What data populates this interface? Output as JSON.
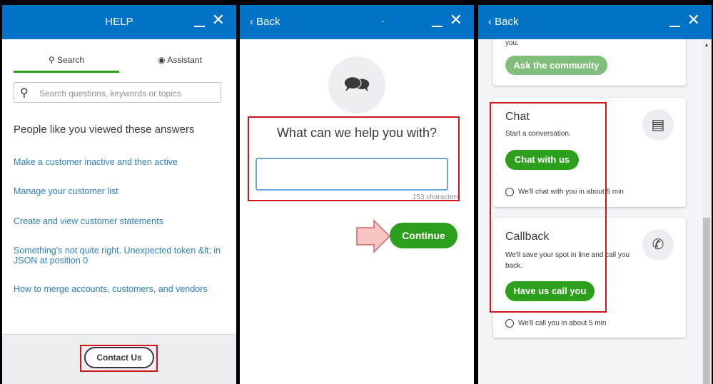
{
  "panel1": {
    "title": "HELP",
    "tabs": [
      {
        "label": "Search",
        "active": true
      },
      {
        "label": "Assistant"
      }
    ],
    "search_placeholder": "Search questions, keywords or topics",
    "heading": "People like you viewed these answers",
    "links": [
      "Make a customer inactive and then active",
      "Manage your customer list",
      "Create and view customer statements",
      "Something's not quite right. Unexpected token &lt; in JSON at position 0",
      "How to merge accounts, customers, and vendors"
    ],
    "contact_label": "Contact Us"
  },
  "panel2": {
    "back_label": "Back",
    "dot": "·",
    "question": "What can we help you with?",
    "input_value": "",
    "char_count": "153 characters",
    "continue_label": "Continue"
  },
  "panel3": {
    "back_label": "Back",
    "community_fragment": "you.",
    "community_button": "Ask the community",
    "chat": {
      "title": "Chat",
      "desc": "Start a conversation.",
      "button": "Chat with us",
      "wait": "We'll chat with you in about 5 min"
    },
    "callback": {
      "title": "Callback",
      "desc": "We'll save your spot in line and call you back.",
      "button": "Have us call you",
      "wait": "We'll call you in about 5 min"
    }
  },
  "colors": {
    "header": "#0073c6",
    "green": "#2ca01c",
    "link": "#2c7fbf",
    "highlight": "#d0141c"
  }
}
